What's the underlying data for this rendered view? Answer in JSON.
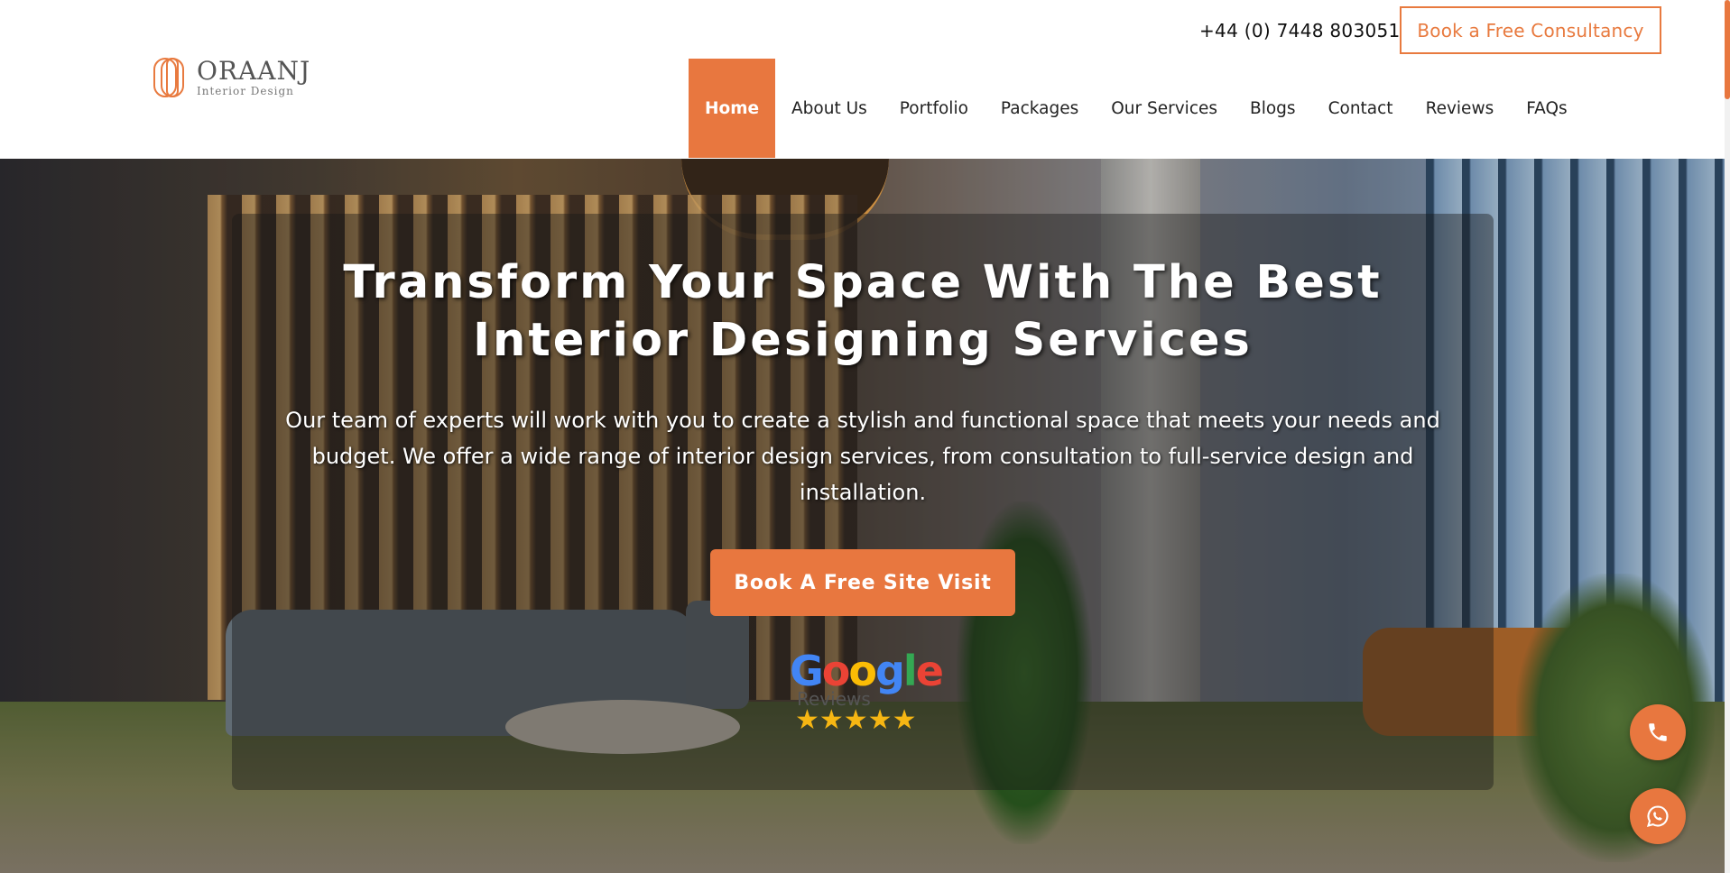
{
  "brand": {
    "name": "ORAANJ",
    "tagline": "Interior Design",
    "accent_color": "#e8773f"
  },
  "header": {
    "phone": "+44 (0) 7448 803051",
    "cta_label": "Book a Free Consultancy"
  },
  "nav": {
    "items": [
      {
        "label": "Home",
        "active": true
      },
      {
        "label": "About Us"
      },
      {
        "label": "Portfolio"
      },
      {
        "label": "Packages"
      },
      {
        "label": "Our Services"
      },
      {
        "label": "Blogs"
      },
      {
        "label": "Contact"
      },
      {
        "label": "Reviews"
      },
      {
        "label": "FAQs"
      }
    ]
  },
  "hero": {
    "title": "Transform Your Space With The Best Interior Designing Services",
    "description": "Our team of experts will work with you to create a stylish and functional space that meets your needs and budget. We offer a wide range of interior design services, from consultation to full-service design and installation.",
    "cta_label": "Book A Free Site Visit"
  },
  "reviews_badge": {
    "brand": "Google",
    "label": "Reviews",
    "stars": "★★★★★"
  },
  "floating": {
    "call_icon": "phone-icon",
    "chat_icon": "whatsapp-icon"
  }
}
